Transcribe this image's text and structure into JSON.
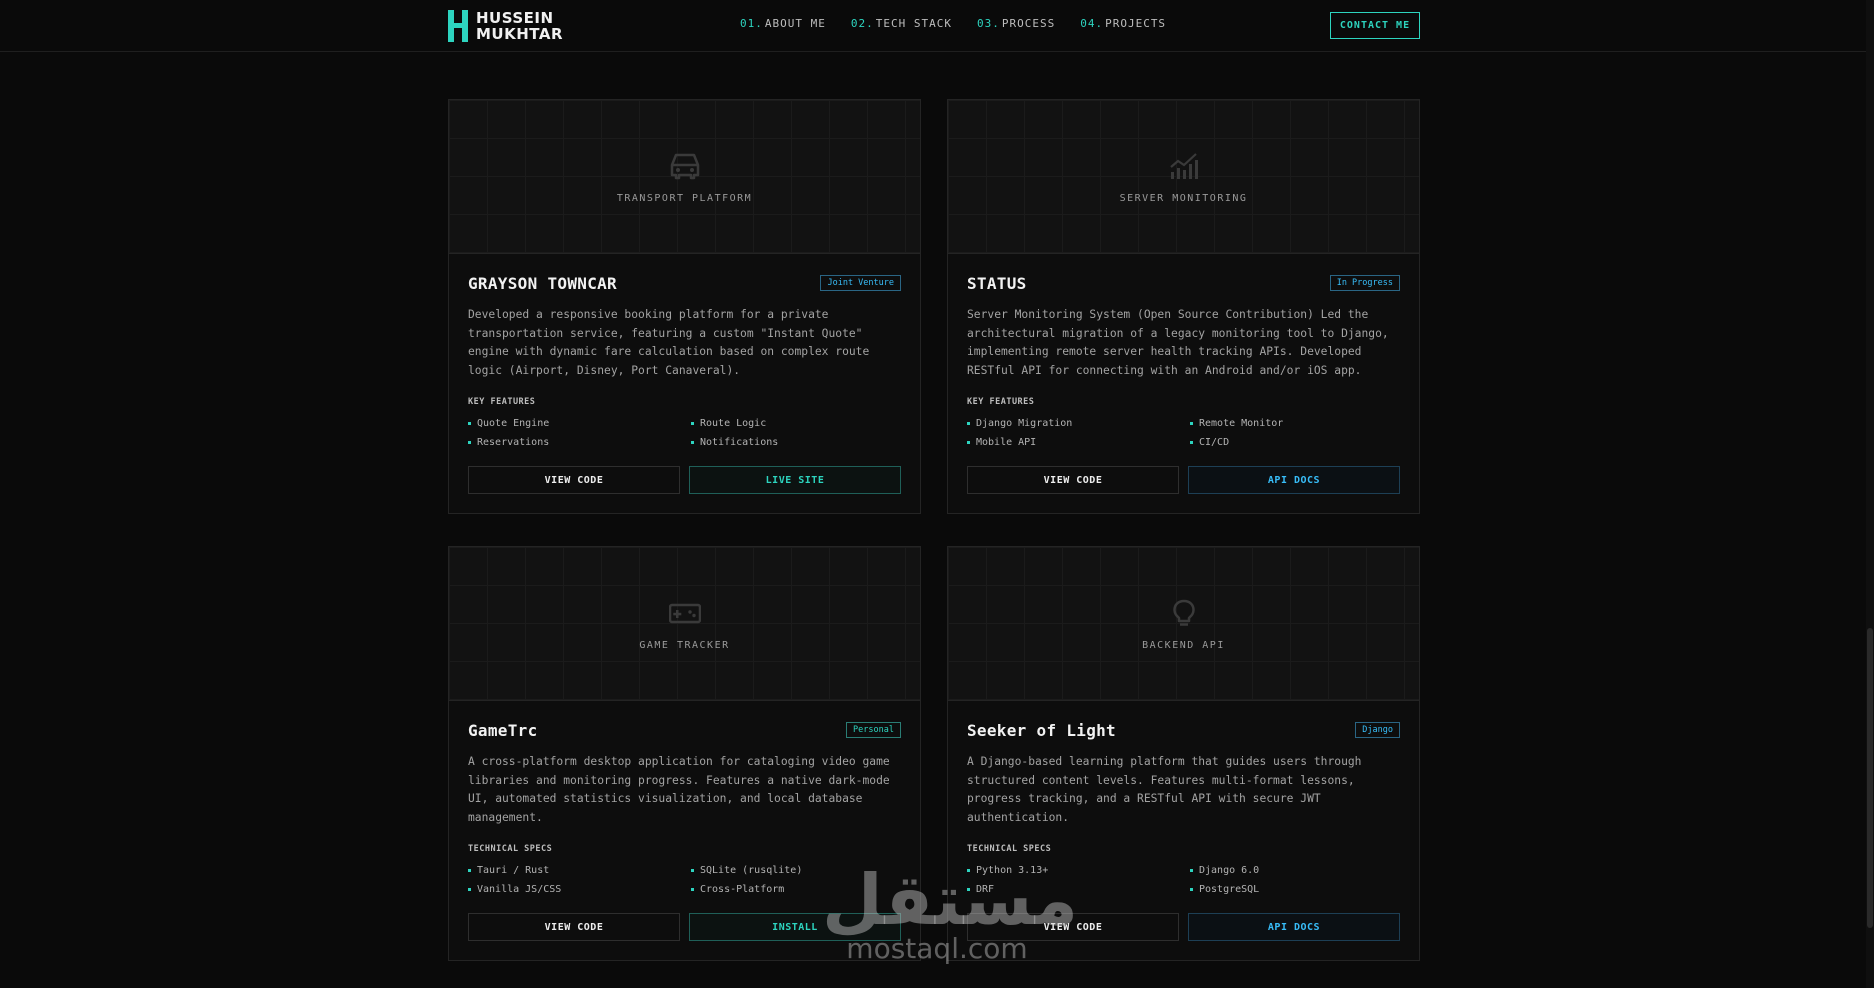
{
  "header": {
    "logo_line1": "HUSSEIN",
    "logo_line2": "MUKHTAR",
    "nav": [
      {
        "num": "01.",
        "label": "ABOUT ME"
      },
      {
        "num": "02.",
        "label": "TECH STACK"
      },
      {
        "num": "03.",
        "label": "PROCESS"
      },
      {
        "num": "04.",
        "label": "PROJECTS"
      }
    ],
    "contact_label": "CONTACT ME"
  },
  "colors": {
    "accent": "#2dd4bf",
    "secondary": "#38bdf8",
    "background": "#0a0a0a"
  },
  "projects": [
    {
      "hero_label": "TRANSPORT PLATFORM",
      "hero_icon": "car-icon",
      "title": "GRAYSON TOWNCAR",
      "badge": "Joint Venture",
      "description": "Developed a responsive booking platform for a private transportation service, featuring a custom \"Instant Quote\" engine with dynamic fare calculation based on complex route logic (Airport, Disney, Port Canaveral).",
      "features_heading": "KEY FEATURES",
      "features": [
        "Quote Engine",
        "Route Logic",
        "Reservations",
        "Notifications"
      ],
      "primary_button": "VIEW CODE",
      "secondary_button": "LIVE SITE"
    },
    {
      "hero_label": "SERVER MONITORING",
      "hero_icon": "chart-icon",
      "title": "STATUS",
      "badge": "In Progress",
      "description": "Server Monitoring System (Open Source Contribution) Led the architectural migration of a legacy monitoring tool to Django, implementing remote server health tracking APIs. Developed RESTful API for connecting with an Android and/or iOS app.",
      "features_heading": "KEY FEATURES",
      "features": [
        "Django Migration",
        "Remote Monitor",
        "Mobile API",
        "CI/CD"
      ],
      "primary_button": "VIEW CODE",
      "secondary_button": "API DOCS"
    },
    {
      "hero_label": "GAME TRACKER",
      "hero_icon": "gamepad-icon",
      "title": "GameTrc",
      "badge": "Personal",
      "description": "A cross-platform desktop application for cataloging video game libraries and monitoring progress. Features a native dark-mode UI, automated statistics visualization, and local database management.",
      "features_heading": "TECHNICAL SPECS",
      "features": [
        "Tauri / Rust",
        "SQLite (rusqlite)",
        "Vanilla JS/CSS",
        "Cross-Platform"
      ],
      "primary_button": "VIEW CODE",
      "secondary_button": "INSTALL"
    },
    {
      "hero_label": "BACKEND API",
      "hero_icon": "lightbulb-icon",
      "title": "Seeker of Light",
      "badge": "Django",
      "description": "A Django-based learning platform that guides users through structured content levels. Features multi-format lessons, progress tracking, and a RESTful API with secure JWT authentication.",
      "features_heading": "TECHNICAL SPECS",
      "features": [
        "Python 3.13+",
        "Django 6.0",
        "DRF",
        "PostgreSQL"
      ],
      "primary_button": "VIEW CODE",
      "secondary_button": "API DOCS"
    }
  ],
  "watermark": {
    "arabic": "مستقل",
    "latin": "mostaql.com"
  }
}
